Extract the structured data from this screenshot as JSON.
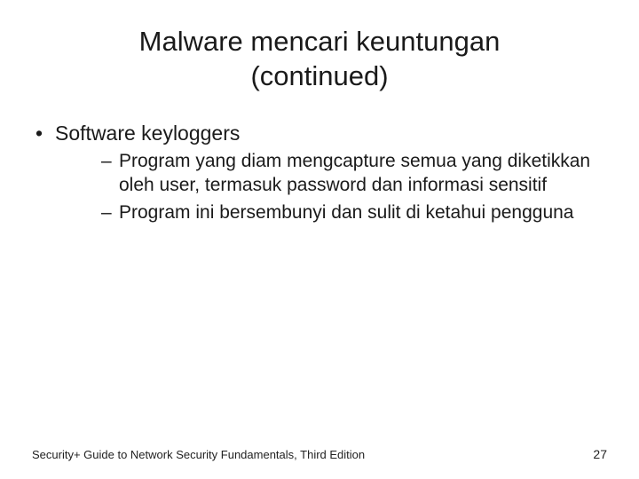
{
  "title_line1": "Malware mencari keuntungan",
  "title_line2": "(continued)",
  "content": {
    "level1": "Software keyloggers",
    "sub": [
      "Program yang diam mengcapture semua yang diketikkan oleh user, termasuk password dan informasi sensitif",
      "Program ini bersembunyi dan sulit di ketahui pengguna"
    ]
  },
  "footer": "Security+ Guide to Network Security Fundamentals, Third Edition",
  "page_number": "27"
}
